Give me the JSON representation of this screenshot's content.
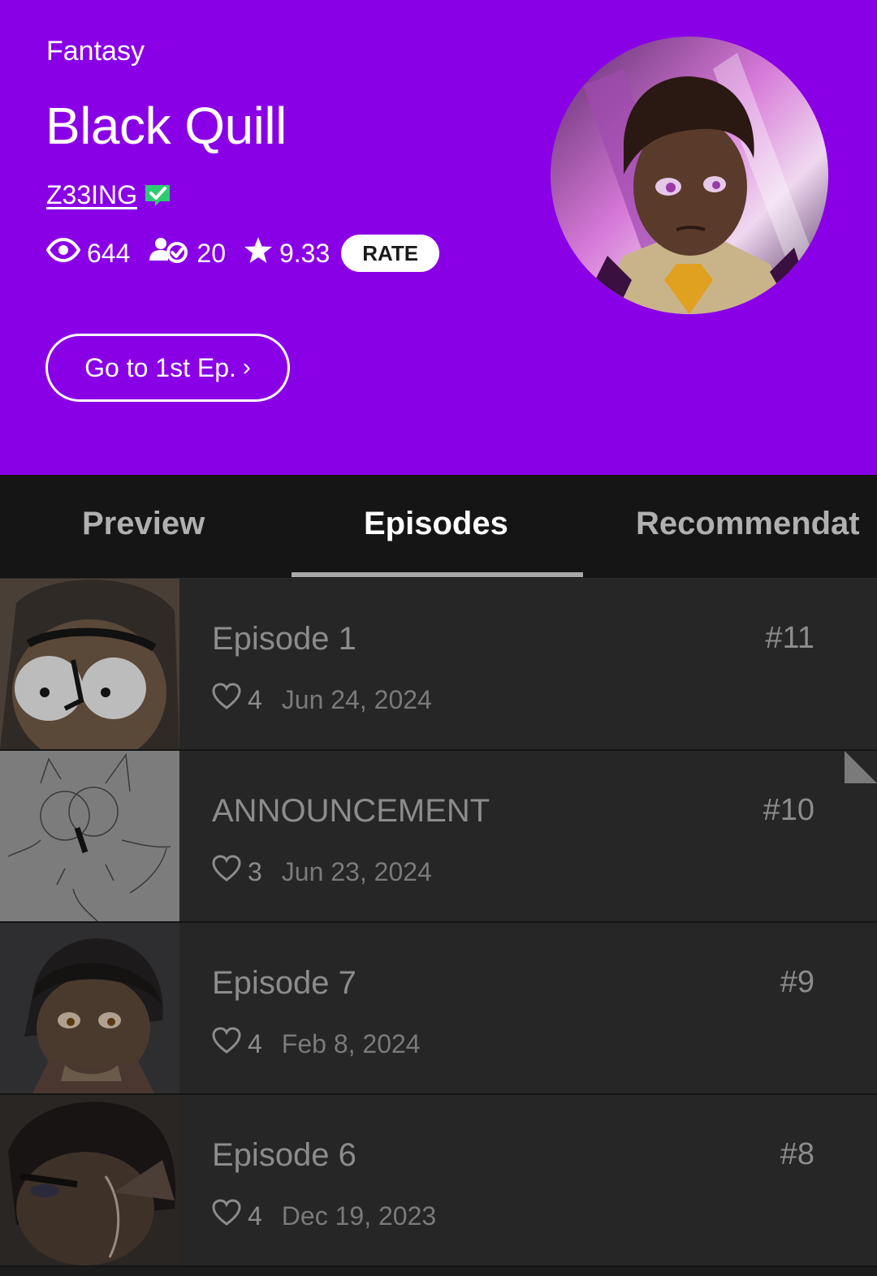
{
  "series": {
    "genre": "Fantasy",
    "title": "Black Quill",
    "author": "Z33ING",
    "views": "644",
    "subscribers": "20",
    "rating": "9.33",
    "rate_label": "RATE",
    "first_episode_label": "Go to 1st Ep."
  },
  "tabs": [
    {
      "label": "Preview",
      "active": false
    },
    {
      "label": "Episodes",
      "active": true
    },
    {
      "label": "Recommendat",
      "active": false
    }
  ],
  "episodes": [
    {
      "title": "Episode 1",
      "number": "#11",
      "likes": "4",
      "date": "Jun 24, 2024"
    },
    {
      "title": "ANNOUNCEMENT",
      "number": "#10",
      "likes": "3",
      "date": "Jun 23, 2024"
    },
    {
      "title": "Episode 7",
      "number": "#9",
      "likes": "4",
      "date": "Feb 8, 2024"
    },
    {
      "title": "Episode 6",
      "number": "#8",
      "likes": "4",
      "date": "Dec 19, 2023"
    }
  ],
  "colors": {
    "header_bg": "#8a00e6",
    "verified_badge": "#2ecc71",
    "tab_bar_bg": "#151515",
    "episode_bg": "#262626"
  },
  "icons": [
    "eye-icon",
    "subscribers-icon",
    "star-icon",
    "verified-icon",
    "chevron-right-icon",
    "heart-icon"
  ]
}
